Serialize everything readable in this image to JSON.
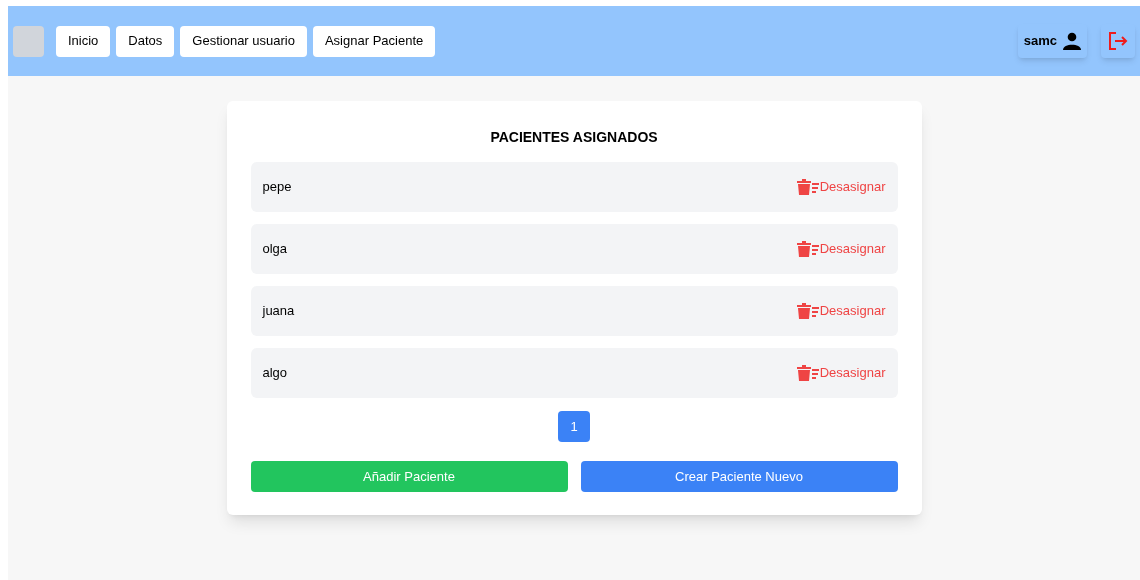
{
  "nav": {
    "links": [
      {
        "label": "Inicio"
      },
      {
        "label": "Datos"
      },
      {
        "label": "Gestionar usuario"
      },
      {
        "label": "Asignar Paciente"
      }
    ],
    "user": "samc"
  },
  "card": {
    "title": "PACIENTES ASIGNADOS",
    "patients": [
      {
        "name": "pepe",
        "action": "Desasignar"
      },
      {
        "name": "olga",
        "action": "Desasignar"
      },
      {
        "name": "juana",
        "action": "Desasignar"
      },
      {
        "name": "algo",
        "action": "Desasignar"
      }
    ],
    "pages": [
      {
        "label": "1",
        "selected": true
      }
    ],
    "buttons": [
      {
        "label": "Añadir Paciente",
        "kind": "add"
      },
      {
        "label": "Crear Paciente Nuevo",
        "kind": "create"
      }
    ]
  }
}
